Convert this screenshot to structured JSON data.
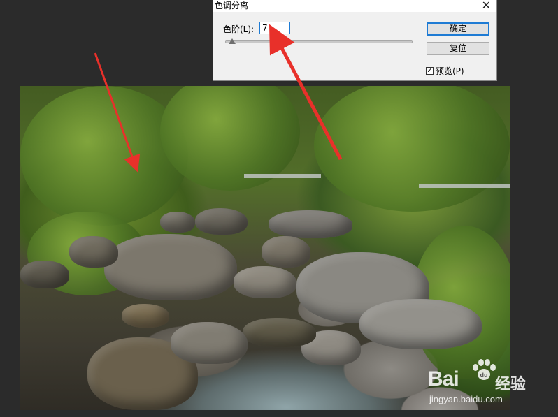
{
  "dialog": {
    "title": "色调分离",
    "close_glyph": "✕",
    "levels_label": "色阶(L):",
    "levels_value": "7",
    "slider_level": 0.02,
    "ok_label": "确定",
    "reset_label": "复位",
    "preview_label": "预览(P)",
    "preview_checked": true
  },
  "watermark": {
    "brand": "Bai",
    "brand_suffix": "经验",
    "url": "jingyan.baidu.com"
  },
  "annotations": {
    "arrow_color": "#e8302a"
  }
}
